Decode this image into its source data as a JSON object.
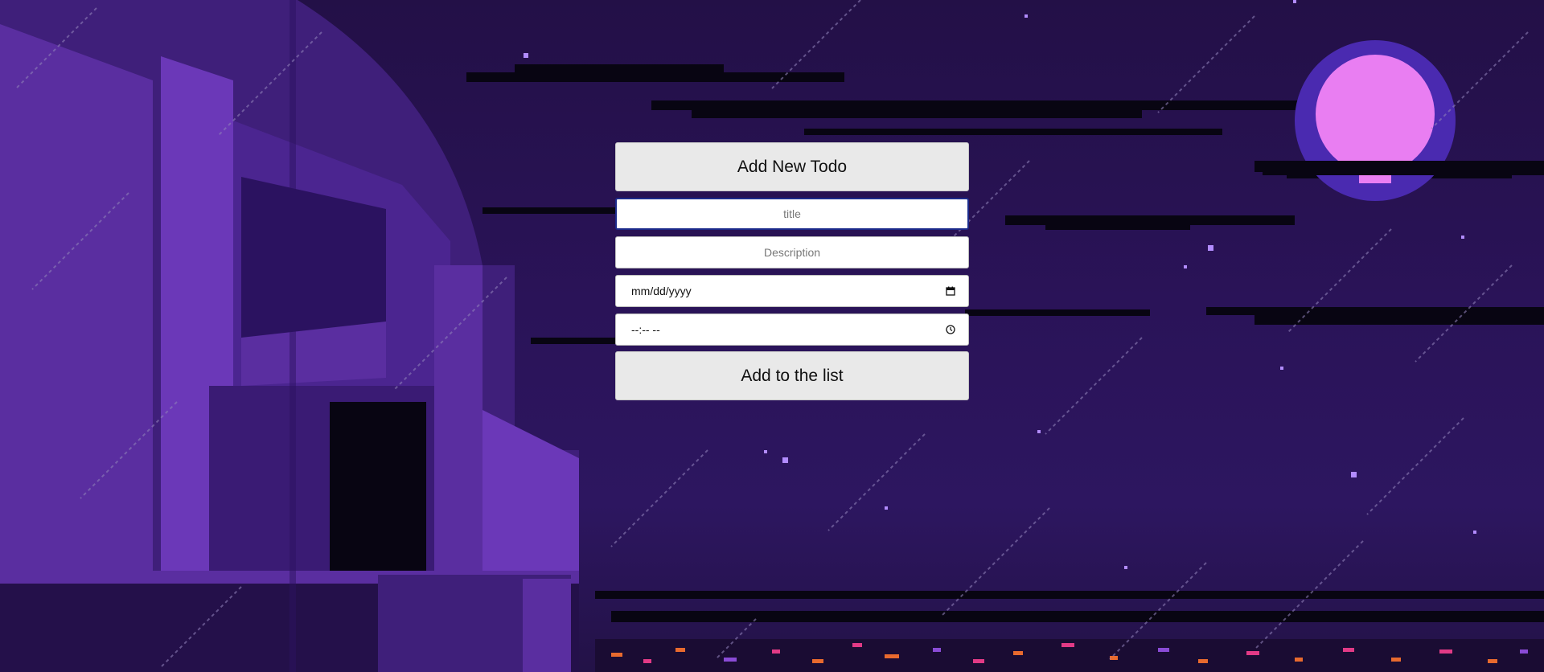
{
  "form": {
    "heading": "Add New Todo",
    "title_placeholder": "title",
    "description_placeholder": "Description",
    "date_placeholder": "mm/dd/yyyy",
    "time_placeholder": "--:-- --",
    "submit_label": "Add to the list"
  },
  "icons": {
    "date_icon": "calendar-icon",
    "time_icon": "clock-icon"
  },
  "colors": {
    "sky": "#2a1358",
    "moon": "#e97ef2",
    "building": "#5a2ea0",
    "button_bg": "#e9e9e9",
    "focus_border": "#1b2a8a"
  }
}
